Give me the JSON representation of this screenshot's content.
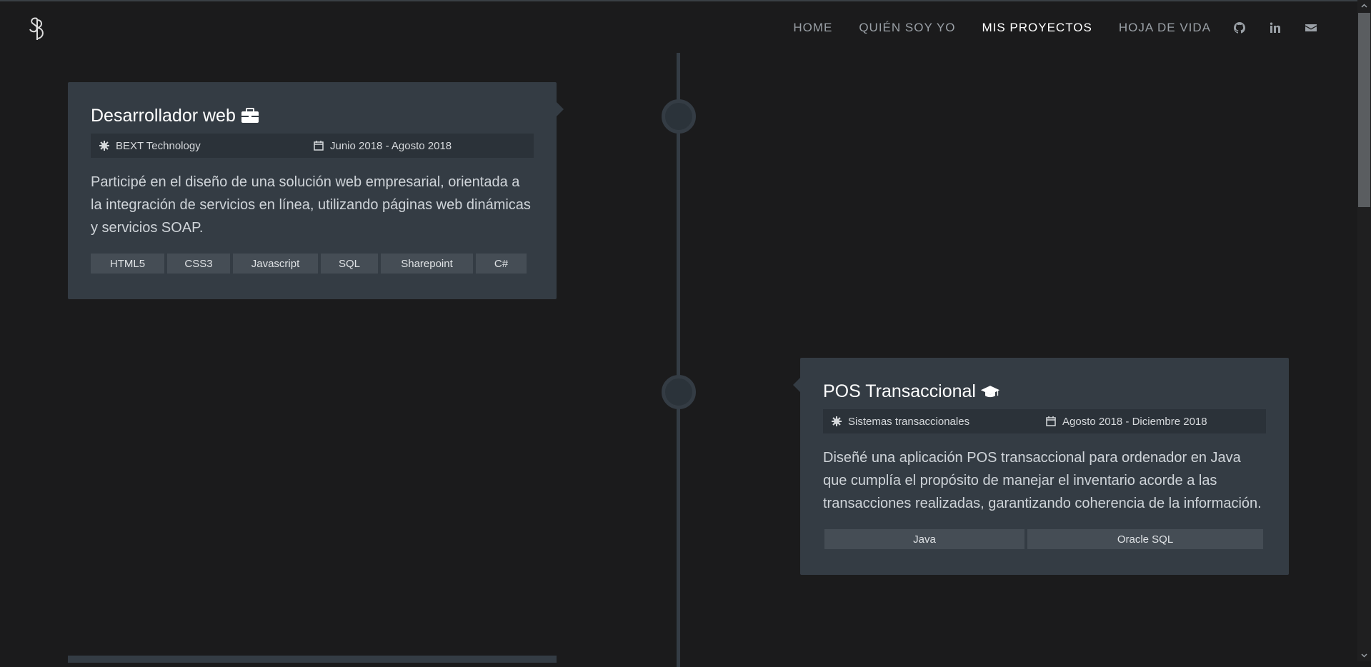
{
  "nav": {
    "logo_text": "SB",
    "items": [
      {
        "label": "HOME"
      },
      {
        "label": "QUIÉN SOY YO"
      },
      {
        "label": "MIS PROYECTOS"
      },
      {
        "label": "HOJA DE VIDA"
      }
    ],
    "icons": [
      "github-icon",
      "linkedin-icon",
      "envelope-icon"
    ]
  },
  "cards": [
    {
      "title": "Desarrollador web",
      "title_icon": "briefcase-icon",
      "company": "BEXT Technology",
      "dates": "Junio 2018 - Agosto 2018",
      "description": "Participé en el diseño de una solución web empresarial, orientada a la integración de servicios en línea, utilizando páginas web dinámicas y servicios SOAP.",
      "tags": [
        "HTML5",
        "CSS3",
        "Javascript",
        "SQL",
        "Sharepoint",
        "C#"
      ]
    },
    {
      "title": "POS Transaccional",
      "title_icon": "graduation-cap-icon",
      "company": "Sistemas transaccionales",
      "dates": "Agosto 2018 - Diciembre 2018",
      "description": "Diseñé una aplicación POS transaccional para ordenador en Java que cumplía el propósito de manejar el inventario acorde a las transacciones realizadas, garantizando coherencia de la información.",
      "tags": [
        "Java",
        "Oracle SQL"
      ]
    }
  ],
  "colors": {
    "background": "#1b1b1c",
    "card": "#343c44",
    "meta_bar": "#2b3239",
    "tag": "#454d55",
    "nav_active": "#ffffff",
    "nav_inactive": "#9aa0a6"
  }
}
